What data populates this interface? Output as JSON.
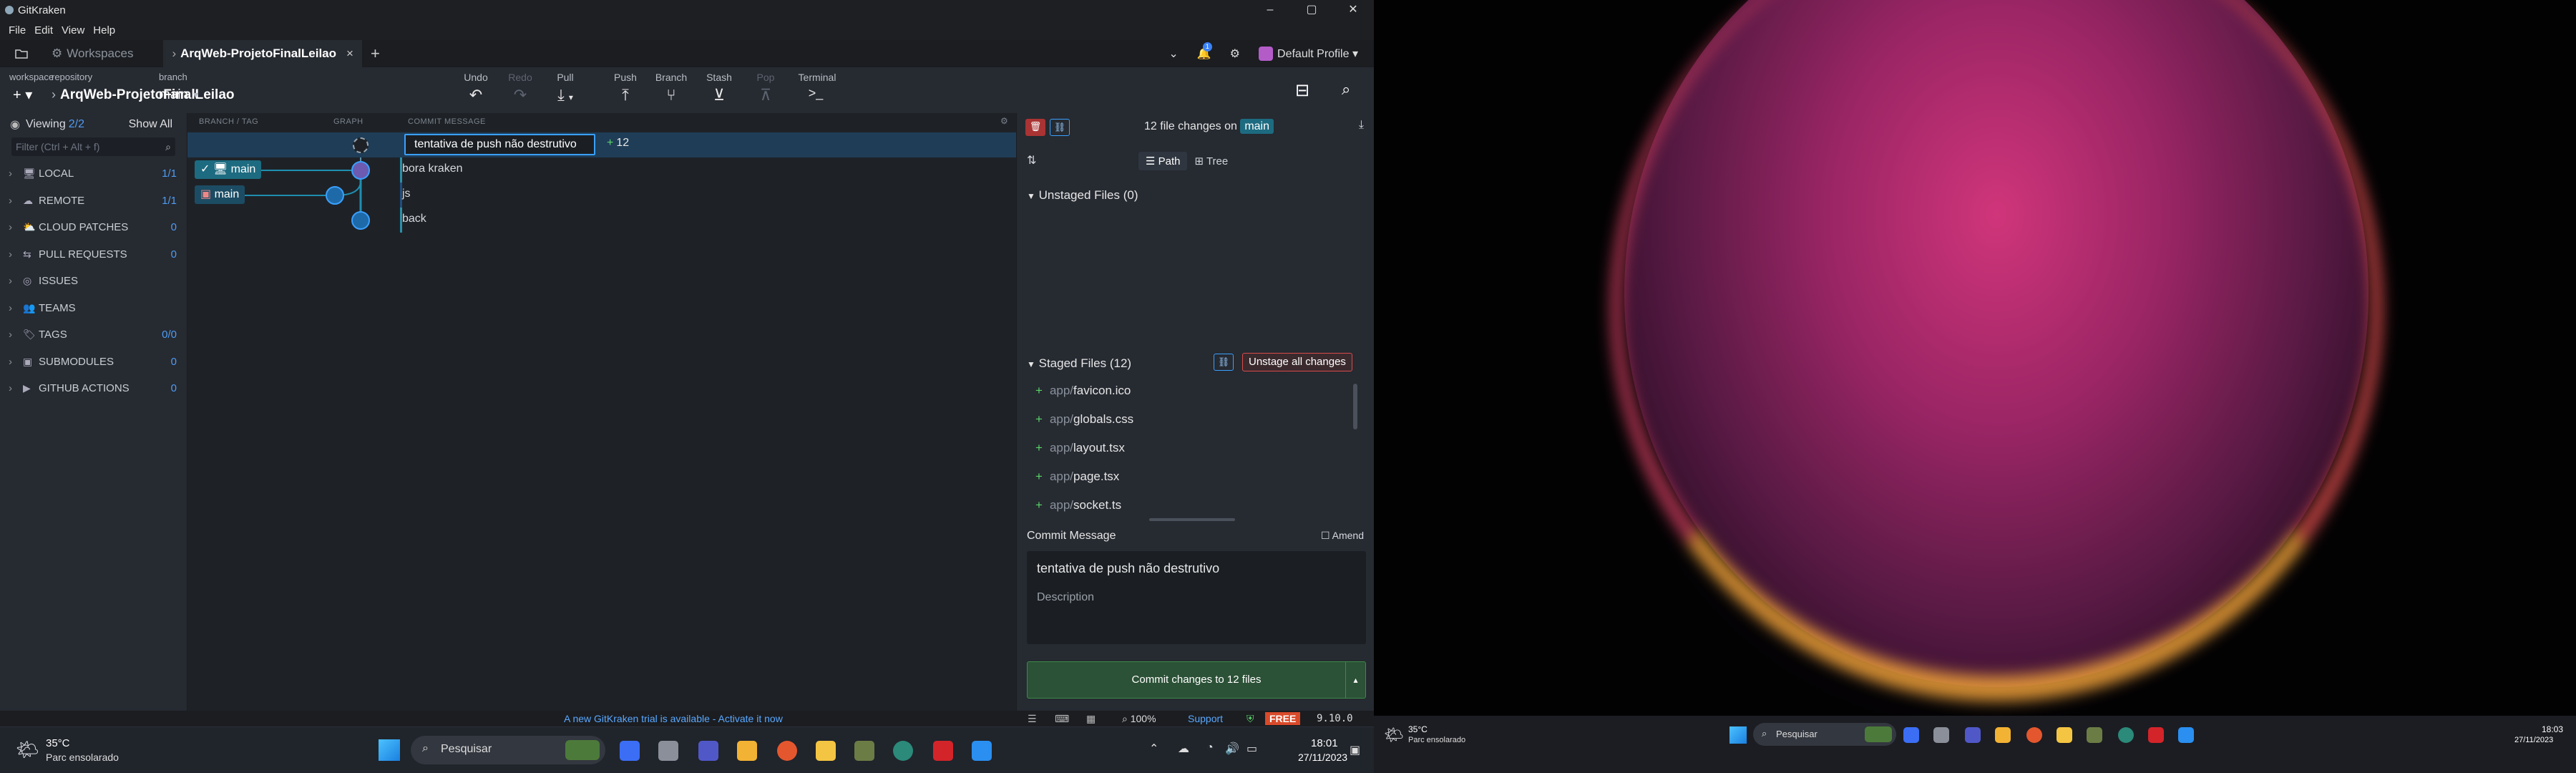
{
  "window": {
    "title": "GitKraken",
    "min": "–",
    "max": "▢",
    "close": "✕"
  },
  "menu": [
    "File",
    "Edit",
    "View",
    "Help"
  ],
  "tabs": {
    "workspaces": "Workspaces",
    "repo": "ArqWeb-ProjetoFinalLeilao",
    "close": "×",
    "add": "+"
  },
  "notifications": {
    "count": "1"
  },
  "profile": "Default Profile",
  "toolbar": {
    "workspace_label": "workspace",
    "repository_label": "repository",
    "repository": "ArqWeb-ProjetoFinalLeilao",
    "branch_label": "branch",
    "branch": "main",
    "undo": "Undo",
    "redo": "Redo",
    "pull": "Pull",
    "push": "Push",
    "branch_btn": "Branch",
    "stash": "Stash",
    "pop": "Pop",
    "terminal": "Terminal"
  },
  "left": {
    "viewing": "Viewing",
    "viewing_count": "2/2",
    "show_all": "Show All",
    "filter_placeholder": "Filter (Ctrl + Alt + f)",
    "items": [
      {
        "label": "LOCAL",
        "count": "1/1",
        "icon": "monitor-icon"
      },
      {
        "label": "REMOTE",
        "count": "1/1",
        "icon": "cloud-icon"
      },
      {
        "label": "CLOUD PATCHES",
        "count": "0",
        "icon": "cloud-patch-icon"
      },
      {
        "label": "PULL REQUESTS",
        "count": "0",
        "icon": "pull-request-icon"
      },
      {
        "label": "ISSUES",
        "count": "",
        "icon": "issue-icon"
      },
      {
        "label": "TEAMS",
        "count": "",
        "icon": "team-icon"
      },
      {
        "label": "TAGS",
        "count": "0/0",
        "icon": "tag-icon"
      },
      {
        "label": "SUBMODULES",
        "count": "0",
        "icon": "submodule-icon"
      },
      {
        "label": "GITHUB ACTIONS",
        "count": "0",
        "icon": "github-actions-icon"
      }
    ]
  },
  "graph": {
    "headers": {
      "branch": "BRANCH / TAG",
      "graph": "GRAPH",
      "message": "COMMIT MESSAGE"
    },
    "wip_message": "tentativa de push não destrutivo",
    "wip_changes": "12",
    "rows": [
      {
        "message": "bora kraken",
        "branch": "main"
      },
      {
        "message": "js",
        "branch": "main"
      },
      {
        "message": "back",
        "branch": ""
      }
    ]
  },
  "right": {
    "changes_text": "12 file changes on",
    "branch": "main",
    "path_label": "Path",
    "tree_label": "Tree",
    "unstaged_title": "Unstaged Files (0)",
    "staged_title": "Staged Files (12)",
    "unstage_all": "Unstage all changes",
    "files": [
      {
        "dir": "app/",
        "name": "favicon.ico"
      },
      {
        "dir": "app/",
        "name": "globals.css"
      },
      {
        "dir": "app/",
        "name": "layout.tsx"
      },
      {
        "dir": "app/",
        "name": "page.tsx"
      },
      {
        "dir": "app/",
        "name": "socket.ts"
      }
    ],
    "commit_message_label": "Commit Message",
    "amend": "Amend",
    "summary": "tentativa de push não destrutivo",
    "description_placeholder": "Description",
    "commit_button": "Commit changes to 12 files"
  },
  "status": {
    "trial": "A new GitKraken trial is available - Activate it now",
    "zoom": "100%",
    "support": "Support",
    "plan": "FREE",
    "version": "9.10.0"
  },
  "taskbar1": {
    "weather_temp": "35°C",
    "weather_desc": "Parc ensolarado",
    "search": "Pesquisar",
    "time": "18:01",
    "date": "27/11/2023"
  },
  "taskbar2": {
    "weather_temp": "35°C",
    "weather_desc": "Parc ensolarado",
    "search": "Pesquisar",
    "time": "18:03",
    "date": "27/11/2023"
  }
}
